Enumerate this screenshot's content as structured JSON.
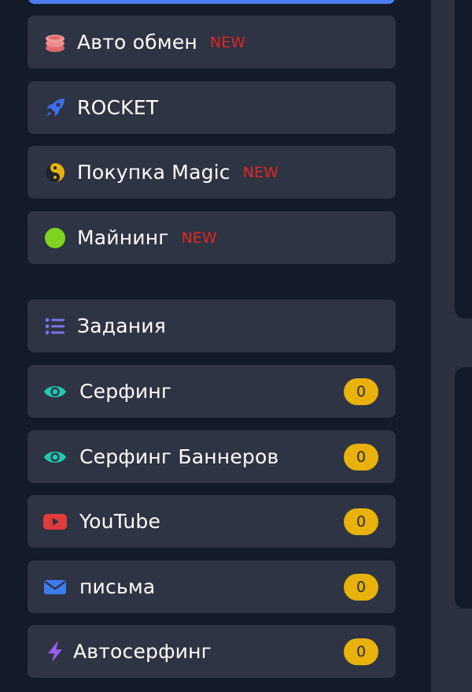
{
  "menu": {
    "items": [
      {
        "label": "Авто обмен",
        "tag": "NEW",
        "icon": "coins-stack-icon"
      },
      {
        "label": "ROCKET",
        "icon": "rocket-icon"
      },
      {
        "label": "Покупка Magic",
        "tag": "NEW",
        "icon": "yin-yang-icon"
      },
      {
        "label": "Майнинг",
        "tag": "NEW",
        "icon": "green-circle-icon"
      },
      {
        "label": "Задания",
        "icon": "task-list-icon"
      },
      {
        "label": "Серфинг",
        "count": "0",
        "icon": "eye-icon"
      },
      {
        "label": "Серфинг Баннеров",
        "count": "0",
        "icon": "eye-icon"
      },
      {
        "label": "YouTube",
        "count": "0",
        "icon": "youtube-icon"
      },
      {
        "label": "письма",
        "count": "0",
        "icon": "envelope-icon"
      },
      {
        "label": "Автосерфинг",
        "count": "0",
        "icon": "lightning-icon"
      }
    ]
  },
  "colors": {
    "background": "#131a2a",
    "item_background": "#2e3443",
    "active_accent": "#4c7df0",
    "new_tag": "#e32626",
    "count_badge": "#e8b10b"
  }
}
